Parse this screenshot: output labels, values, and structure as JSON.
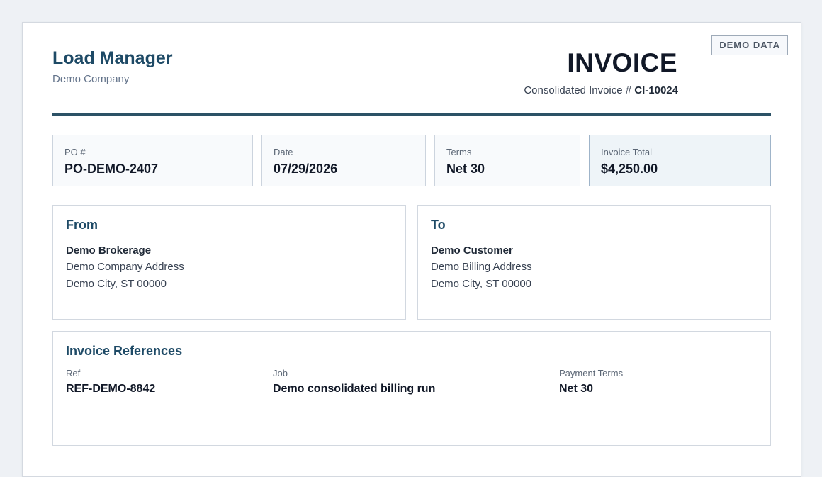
{
  "badge": "DEMO DATA",
  "brand": {
    "name": "Load Manager",
    "company": "Demo Company"
  },
  "invoice": {
    "title": "INVOICE",
    "number_label": "Consolidated Invoice #",
    "number": "CI-10024"
  },
  "summary": [
    {
      "label": "PO #",
      "value": "PO-DEMO-2407"
    },
    {
      "label": "Date",
      "value": "07/29/2026"
    },
    {
      "label": "Terms",
      "value": "Net 30"
    },
    {
      "label": "Invoice Total",
      "value": "$4,250.00"
    }
  ],
  "from": {
    "heading": "From",
    "name": "Demo Brokerage",
    "address1": "Demo Company Address",
    "address2": "Demo City, ST 00000"
  },
  "to": {
    "heading": "To",
    "name": "Demo Customer",
    "address1": "Demo Billing Address",
    "address2": "Demo City, ST 00000"
  },
  "references": {
    "heading": "Invoice References",
    "ref": {
      "label": "Ref",
      "value": "REF-DEMO-8842"
    },
    "job": {
      "label": "Job",
      "value": "Demo consolidated billing run"
    },
    "payment_terms": {
      "label": "Payment Terms",
      "value": "Net 30"
    }
  },
  "colors": {
    "accent": "#1e4a66",
    "rule": "#2c5266",
    "total_bg": "#eef4f8"
  }
}
